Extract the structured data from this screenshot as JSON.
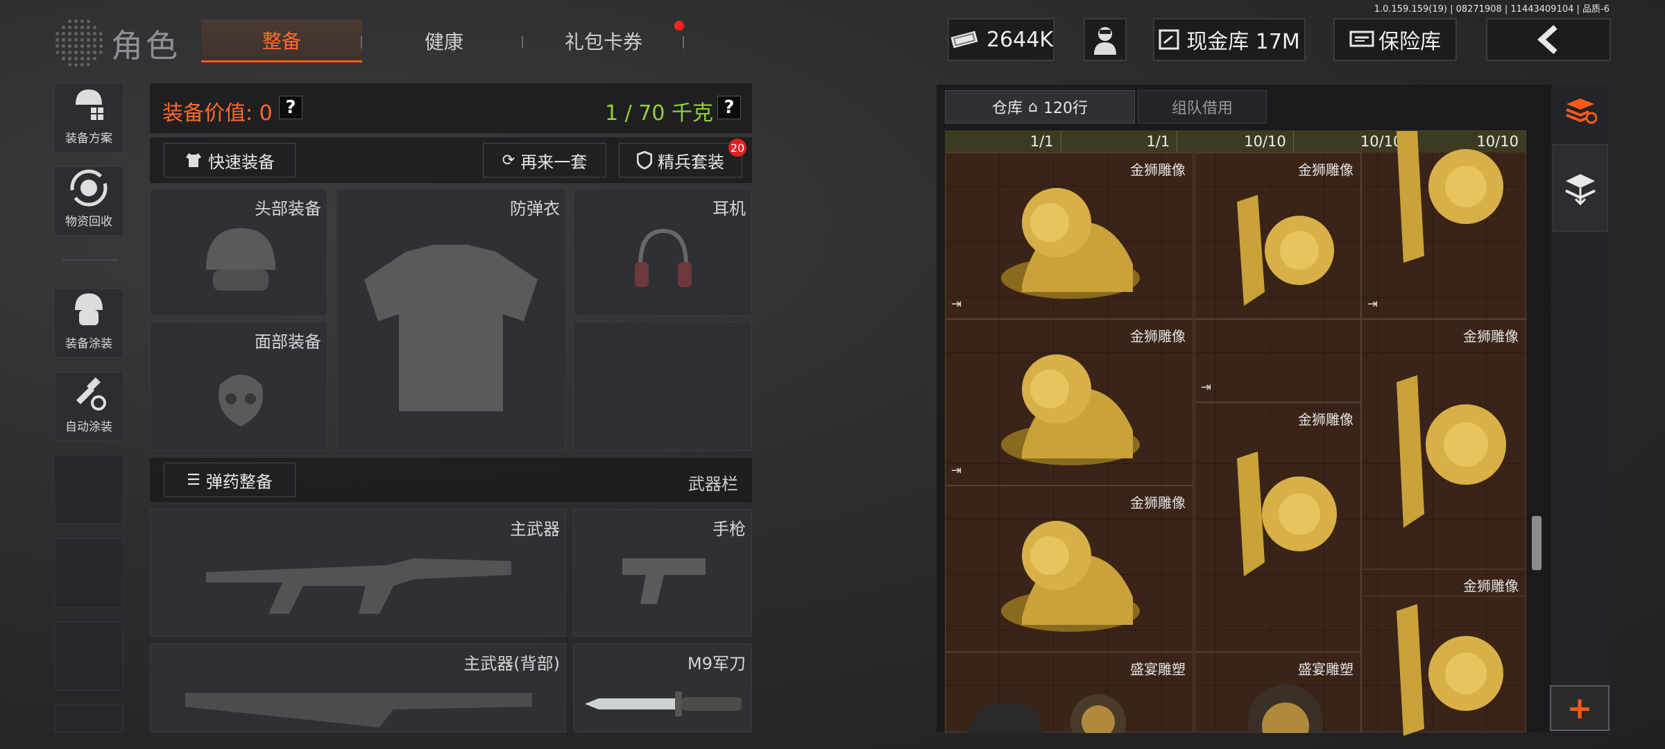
{
  "version_text": "1.0.159.159(19) | 08271908 | 11443409104 | 品质-6",
  "header": {
    "title": "角色",
    "tabs": [
      {
        "label": "整备",
        "active": true
      },
      {
        "label": "健康",
        "active": false
      },
      {
        "label": "礼包卡券",
        "active": false
      }
    ],
    "money": "2644K",
    "cash_vault": "现金库 17M",
    "safe_box": "保险库"
  },
  "sidebar": {
    "items": [
      {
        "label": "装备方案",
        "icon": "loadout-icon"
      },
      {
        "label": "物资回收",
        "icon": "recycle-icon"
      },
      {
        "label": "装备涂装",
        "icon": "helmet-paint-icon"
      },
      {
        "label": "自动涂装",
        "icon": "auto-paint-icon"
      }
    ]
  },
  "equipment": {
    "value_label": "装备价值: 0",
    "weight": "1 / 70 千克",
    "quick_equip": "快速装备",
    "again_set": "再来一套",
    "elite_set": "精兵套装",
    "elite_badge": "20",
    "slots": {
      "head": "头部装备",
      "armor": "防弹衣",
      "headset": "耳机",
      "face": "面部装备"
    },
    "ammo_button": "弹药整备",
    "weapon_bar": "武器栏",
    "weapon_slots": {
      "primary": "主武器",
      "pistol": "手枪",
      "primary_back": "主武器(背部)",
      "knife": "M9军刀"
    }
  },
  "storage": {
    "tab_warehouse": "仓库",
    "rows": "120行",
    "tab_team": "组队借用",
    "top_counts": [
      "1/1",
      "1/1",
      "10/10",
      "10/10",
      "10/10"
    ],
    "items": [
      {
        "name": "金狮雕像"
      },
      {
        "name": "金狮雕像"
      },
      {
        "name": "金狮雕像"
      },
      {
        "name": "金狮雕像"
      },
      {
        "name": "金狮雕像"
      },
      {
        "name": "金狮雕像"
      },
      {
        "name": "金狮雕像"
      },
      {
        "name": "盛宴雕塑"
      },
      {
        "name": "盛宴雕塑"
      }
    ]
  },
  "colors": {
    "accent_orange": "#ff6a2a",
    "weight_green": "#8fd13a",
    "grid_brown": "#3a2418",
    "gold": "#c9a23a"
  },
  "add_button": "+"
}
